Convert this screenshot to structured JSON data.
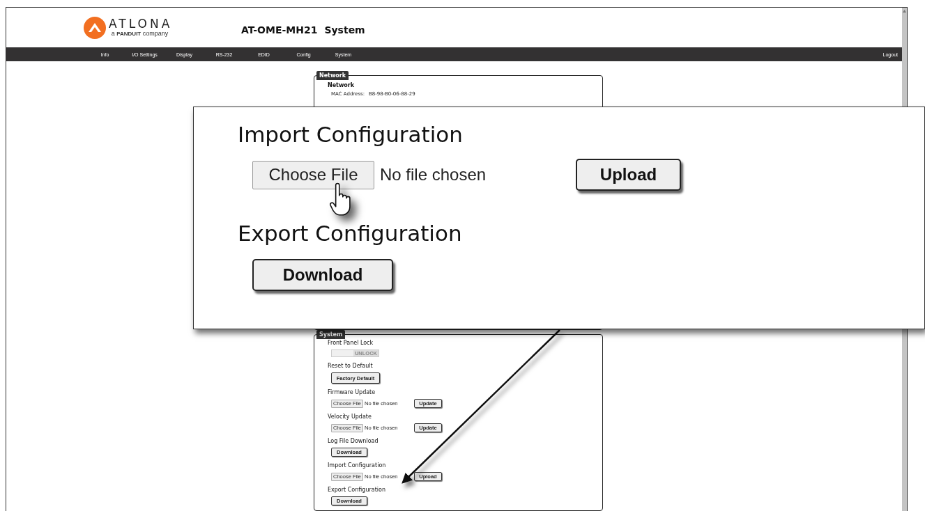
{
  "header": {
    "logo": {
      "wordmark": "ATLONA",
      "tagline_prefix": "a",
      "tagline_brand": "PANDUIT",
      "tagline_suffix": "company"
    },
    "device": "AT-OME-MH21",
    "page": "System"
  },
  "nav": {
    "items": [
      "Info",
      "I/O Settings",
      "Display",
      "RS-232",
      "EDID",
      "Config",
      "System"
    ],
    "logout": "Logout"
  },
  "network": {
    "legend": "Network",
    "heading": "Network",
    "mac_label": "MAC Address:",
    "mac_value": "B8-98-B0-06-88-29"
  },
  "system": {
    "legend": "System",
    "sections": [
      {
        "kind": "toggle",
        "title": "Front Panel Lock",
        "label": "UNLOCK",
        "on": false
      },
      {
        "kind": "button",
        "title": "Reset to Default",
        "button": "Factory Default"
      },
      {
        "kind": "file",
        "title": "Firmware Update",
        "choose": "Choose File",
        "status": "No file chosen",
        "button": "Update"
      },
      {
        "kind": "file",
        "title": "Velocity Update",
        "choose": "Choose File",
        "status": "No file chosen",
        "button": "Update"
      },
      {
        "kind": "button",
        "title": "Log File Download",
        "button": "Download"
      },
      {
        "kind": "file",
        "title": "Import Configuration",
        "choose": "Choose File",
        "status": "No file chosen",
        "button": "Upload"
      },
      {
        "kind": "button",
        "title": "Export Configuration",
        "button": "Download"
      }
    ]
  },
  "callout": {
    "import_title": "Import Configuration",
    "choose": "Choose File",
    "status": "No file chosen",
    "upload": "Upload",
    "export_title": "Export Configuration",
    "download": "Download"
  }
}
